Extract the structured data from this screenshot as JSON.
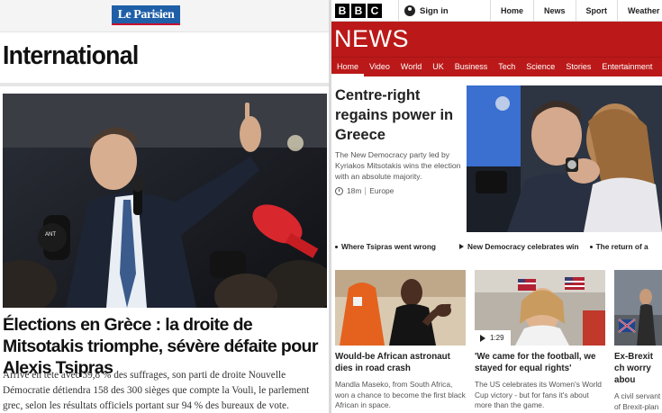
{
  "parisien": {
    "logo": "Le Parisien",
    "section_title": "International",
    "headline": "Élections en Grèce : la droite de Mitsotakis triomphe, sévère défaite pour Alexis Tsipras",
    "body": "Arrivé en tête avec 39,8 % des suffrages, son parti de droite Nouvelle Démocratie détiendra 158 des 300 sièges que compte la Vouli, le parlement grec, selon les résultats officiels portant sur 94 % des bureaux de vote."
  },
  "bbc": {
    "logo_letters": [
      "B",
      "B",
      "C"
    ],
    "sign_in": "Sign in",
    "top_nav": [
      "Home",
      "News",
      "Sport",
      "Weather"
    ],
    "news_wordmark": "NEWS",
    "nav": [
      "Home",
      "Video",
      "World",
      "UK",
      "Business",
      "Tech",
      "Science",
      "Stories",
      "Entertainment"
    ],
    "active_nav": "Home",
    "lead": {
      "title": "Centre-right regains power in Greece",
      "summary": "The New Democracy party led by Kyriakos Mitsotakis wins the election with an absolute majority.",
      "time": "18m",
      "tag": "Europe"
    },
    "related": [
      {
        "text": "Where Tsipras went wrong",
        "type": "article"
      },
      {
        "text": "New Democracy celebrates win",
        "type": "video"
      },
      {
        "text": "The return of a",
        "type": "article"
      }
    ],
    "cards": [
      {
        "title": "Would-be African astronaut dies in road crash",
        "summary": "Mandla Maseko, from South Africa, won a chance to become the first black African in space."
      },
      {
        "title": "'We came for the football, we stayed for equal rights'",
        "summary": "The US celebrates its Women's World Cup victory - but for fans it's about more than the game.",
        "video_duration": "1:29"
      },
      {
        "title": "Ex-Brexit ch worry abou",
        "summary": "A civil servant of Brexit-plan dea finds"
      }
    ]
  }
}
